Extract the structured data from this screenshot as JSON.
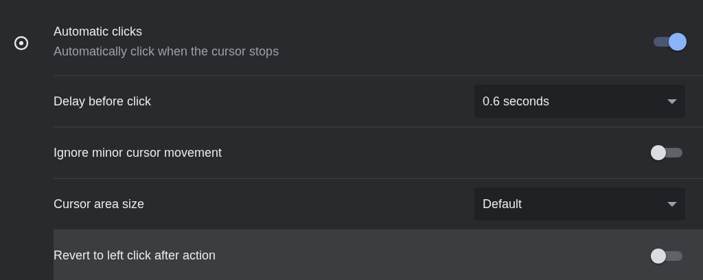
{
  "feature": {
    "title": "Automatic clicks",
    "subtitle": "Automatically click when the cursor stops",
    "on": true
  },
  "rows": [
    {
      "kind": "dropdown",
      "label": "Delay before click",
      "value": "0.6 seconds",
      "highlighted": false
    },
    {
      "kind": "toggle",
      "label": "Ignore minor cursor movement",
      "on": false,
      "highlighted": false
    },
    {
      "kind": "dropdown",
      "label": "Cursor area size",
      "value": "Default",
      "highlighted": false
    },
    {
      "kind": "toggle",
      "label": "Revert to left click after action",
      "on": false,
      "highlighted": true
    }
  ]
}
